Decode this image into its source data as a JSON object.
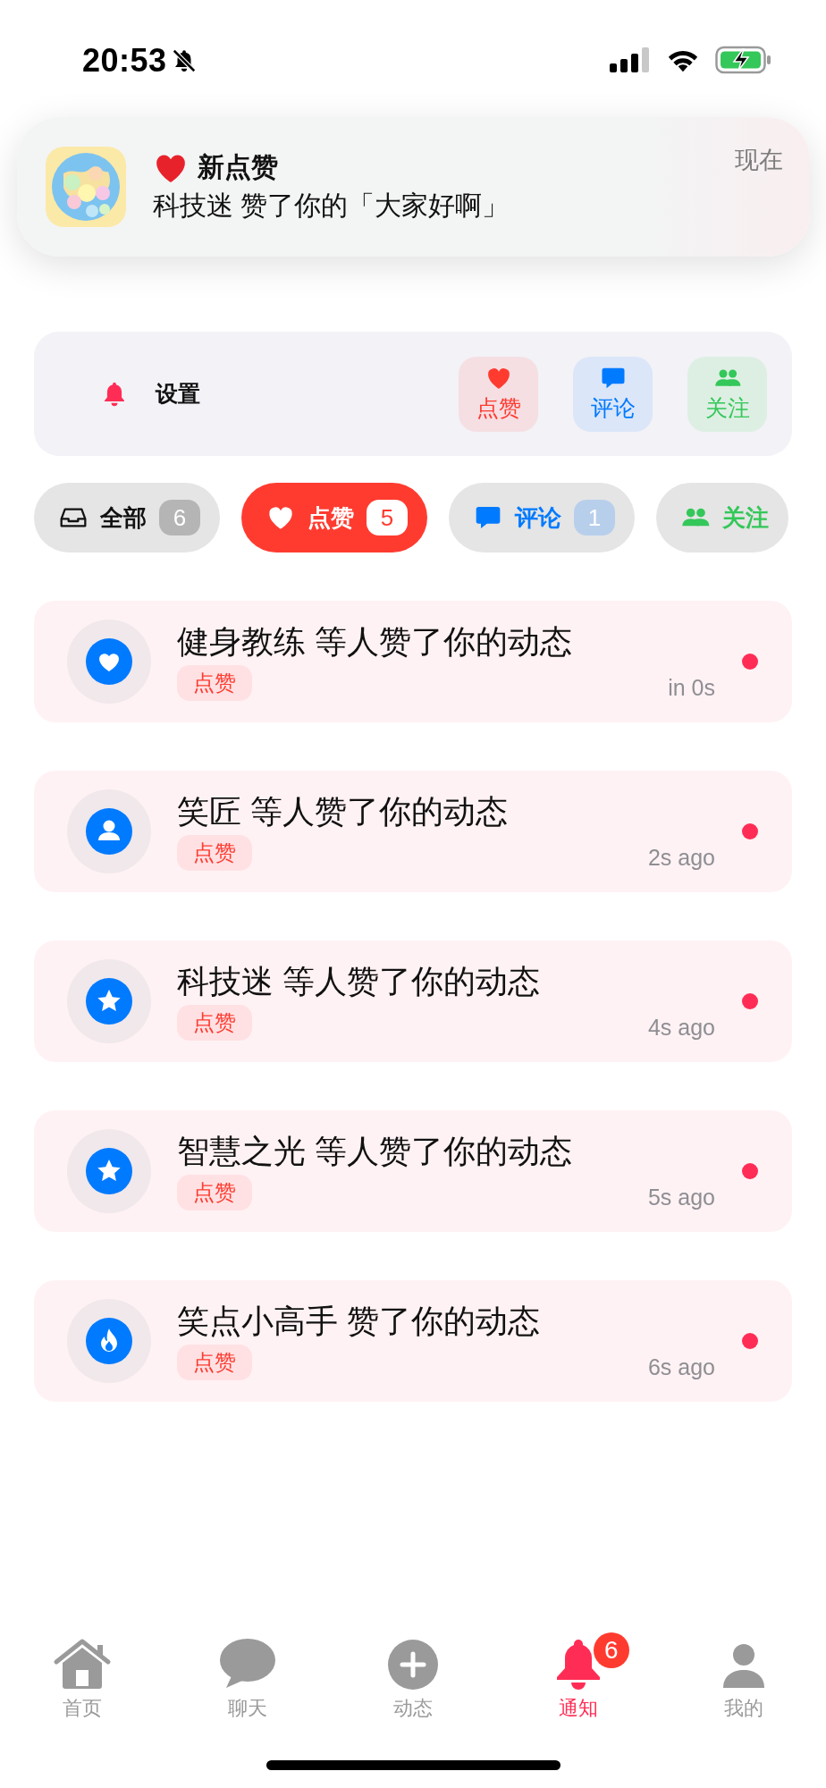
{
  "status_bar": {
    "time": "20:53"
  },
  "banner": {
    "title": "新点赞",
    "message": "科技迷 赞了你的「大家好啊」",
    "time": "现在"
  },
  "settings": {
    "label": "设置",
    "shortcuts": [
      {
        "kind": "like",
        "label": "点赞"
      },
      {
        "kind": "comment",
        "label": "评论"
      },
      {
        "kind": "follow",
        "label": "关注"
      }
    ]
  },
  "filters": [
    {
      "kind": "all",
      "label": "全部",
      "count": "6",
      "selected": false
    },
    {
      "kind": "like",
      "label": "点赞",
      "count": "5",
      "selected": true
    },
    {
      "kind": "comment",
      "label": "评论",
      "count": "1",
      "selected": false
    },
    {
      "kind": "follow",
      "label": "关注",
      "selected": false
    }
  ],
  "notifications": [
    {
      "kind": "heart",
      "title": "健身教练 等人赞了你的动态",
      "tag": "点赞",
      "time": "in 0s",
      "unread": true
    },
    {
      "kind": "person",
      "title": "笑匠 等人赞了你的动态",
      "tag": "点赞",
      "time": "2s ago",
      "unread": true
    },
    {
      "kind": "star",
      "title": "科技迷 等人赞了你的动态",
      "tag": "点赞",
      "time": "4s ago",
      "unread": true
    },
    {
      "kind": "star",
      "title": "智慧之光 等人赞了你的动态",
      "tag": "点赞",
      "time": "5s ago",
      "unread": true
    },
    {
      "kind": "flame",
      "title": "笑点小高手 赞了你的动态",
      "tag": "点赞",
      "time": "6s ago",
      "unread": true
    }
  ],
  "tab_bar": [
    {
      "kind": "home",
      "label": "首页",
      "selected": false
    },
    {
      "kind": "chat",
      "label": "聊天",
      "selected": false
    },
    {
      "kind": "post",
      "label": "动态",
      "selected": false
    },
    {
      "kind": "bell",
      "label": "通知",
      "selected": true,
      "badge": "6"
    },
    {
      "kind": "me",
      "label": "我的",
      "selected": false
    }
  ]
}
